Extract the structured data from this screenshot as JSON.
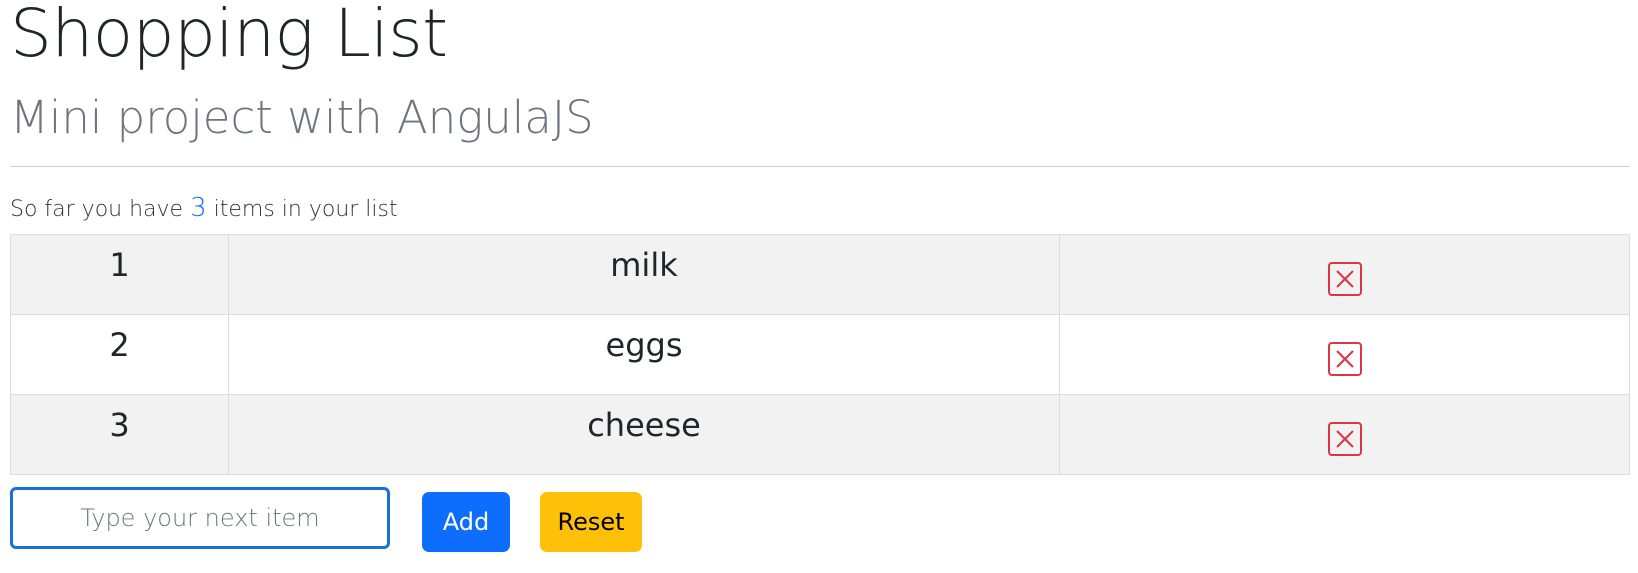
{
  "header": {
    "title": "Shopping List",
    "subtitle": "Mini project with AngulaJS"
  },
  "summary": {
    "prefix": "So far you have",
    "count": "3",
    "suffix": "items in your list"
  },
  "items": [
    {
      "index": "1",
      "name": "milk"
    },
    {
      "index": "2",
      "name": "eggs"
    },
    {
      "index": "3",
      "name": "cheese"
    }
  ],
  "form": {
    "input_value": "",
    "input_placeholder": "Type your next item",
    "add_label": "Add",
    "reset_label": "Reset"
  },
  "icons": {
    "delete": "close-x-icon"
  },
  "colors": {
    "primary": "#0d6efd",
    "warning": "#ffc107",
    "danger": "#dc3545",
    "muted": "#6c757d",
    "stripe": "#f2f2f2"
  }
}
